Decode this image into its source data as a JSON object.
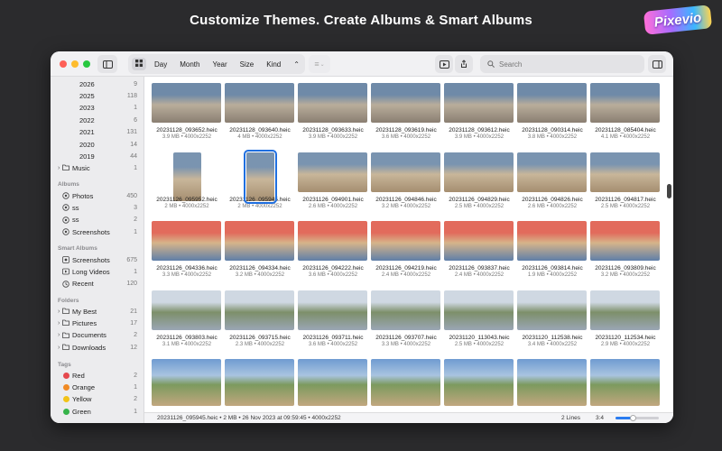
{
  "headline": "Customize Themes. Create Albums & Smart Albums",
  "logo_text": "Pixevio",
  "toolbar": {
    "segments": [
      "Day",
      "Month",
      "Year",
      "Size",
      "Kind"
    ],
    "search_placeholder": "Search"
  },
  "sidebar": {
    "years": [
      {
        "label": "2026",
        "count": "9"
      },
      {
        "label": "2025",
        "count": "118"
      },
      {
        "label": "2023",
        "count": "1"
      },
      {
        "label": "2022",
        "count": "6"
      },
      {
        "label": "2021",
        "count": "131"
      },
      {
        "label": "2020",
        "count": "14"
      },
      {
        "label": "2019",
        "count": "44"
      }
    ],
    "music": {
      "label": "Music",
      "count": "1"
    },
    "albums_header": "Albums",
    "albums": [
      {
        "label": "Photos",
        "count": "450"
      },
      {
        "label": "ss",
        "count": "3"
      },
      {
        "label": "ss",
        "count": "2"
      },
      {
        "label": "Screenshots",
        "count": "1"
      }
    ],
    "smart_header": "Smart Albums",
    "smart": [
      {
        "label": "Screenshots",
        "count": "675"
      },
      {
        "label": "Long Videos",
        "count": "1"
      },
      {
        "label": "Recent",
        "count": "120"
      }
    ],
    "folders_header": "Folders",
    "folders": [
      {
        "label": "My Best",
        "count": "21"
      },
      {
        "label": "Pictures",
        "count": "17"
      },
      {
        "label": "Documents",
        "count": "2"
      },
      {
        "label": "Downloads",
        "count": "12"
      }
    ],
    "tags_header": "Tags",
    "tags": [
      {
        "label": "Red",
        "count": "2",
        "color": "#e5484d"
      },
      {
        "label": "Orange",
        "count": "1",
        "color": "#f08a24"
      },
      {
        "label": "Yellow",
        "count": "2",
        "color": "#f2c318"
      },
      {
        "label": "Green",
        "count": "1",
        "color": "#36b34a"
      }
    ]
  },
  "grid": {
    "rows": [
      [
        {
          "name": "20231128_093652.heic",
          "meta": "3.9 MB • 4000x2252"
        },
        {
          "name": "20231128_093640.heic",
          "meta": "4 MB • 4000x2252"
        },
        {
          "name": "20231128_093633.heic",
          "meta": "3.9 MB • 4000x2252"
        },
        {
          "name": "20231128_093619.heic",
          "meta": "3.6 MB • 4000x2252"
        },
        {
          "name": "20231128_093612.heic",
          "meta": "3.9 MB • 4000x2252"
        },
        {
          "name": "20231128_090314.heic",
          "meta": "3.8 MB • 4000x2252"
        },
        {
          "name": "20231128_085404.heic",
          "meta": "4.1 MB • 4000x2252"
        }
      ],
      [
        {
          "name": "20231126_095952.heic",
          "meta": "2 MB • 4000x2252"
        },
        {
          "name": "20231126_095945.heic",
          "meta": "2 MB • 4000x2252"
        },
        {
          "name": "20231126_094901.heic",
          "meta": "2.6 MB • 4000x2252"
        },
        {
          "name": "20231126_094846.heic",
          "meta": "3.2 MB • 4000x2252"
        },
        {
          "name": "20231126_094829.heic",
          "meta": "2.5 MB • 4000x2252"
        },
        {
          "name": "20231126_094826.heic",
          "meta": "2.6 MB • 4000x2252"
        },
        {
          "name": "20231126_094817.heic",
          "meta": "2.5 MB • 4000x2252"
        }
      ],
      [
        {
          "name": "20231126_094336.heic",
          "meta": "3.3 MB • 4000x2252"
        },
        {
          "name": "20231126_094334.heic",
          "meta": "3.2 MB • 4000x2252"
        },
        {
          "name": "20231126_094222.heic",
          "meta": "3.6 MB • 4000x2252"
        },
        {
          "name": "20231126_094219.heic",
          "meta": "2.4 MB • 4000x2252"
        },
        {
          "name": "20231126_093837.heic",
          "meta": "2.4 MB • 4000x2252"
        },
        {
          "name": "20231126_093814.heic",
          "meta": "1.9 MB • 4000x2252"
        },
        {
          "name": "20231126_093809.heic",
          "meta": "3.2 MB • 4000x2252"
        }
      ],
      [
        {
          "name": "20231126_093803.heic",
          "meta": "3.1 MB • 4000x2252"
        },
        {
          "name": "20231126_093715.heic",
          "meta": "2.3 MB • 4000x2252"
        },
        {
          "name": "20231126_093711.heic",
          "meta": "3.6 MB • 4000x2252"
        },
        {
          "name": "20231126_093707.heic",
          "meta": "3.3 MB • 4000x2252"
        },
        {
          "name": "20231120_113043.heic",
          "meta": "2.5 MB • 4000x2252"
        },
        {
          "name": "20231120_112538.heic",
          "meta": "3.4 MB • 4000x2252"
        },
        {
          "name": "20231120_112534.heic",
          "meta": "2.9 MB • 4000x2252"
        }
      ]
    ],
    "selected": "20231126_095945.heic"
  },
  "status": {
    "path": "20231126_095945.heic • 2 MB • 26 Nov 2023 at 09:59:45 • 4000x2252",
    "lines": "2 Lines",
    "ratio": "3:4",
    "zoom_fraction": 0.4
  }
}
